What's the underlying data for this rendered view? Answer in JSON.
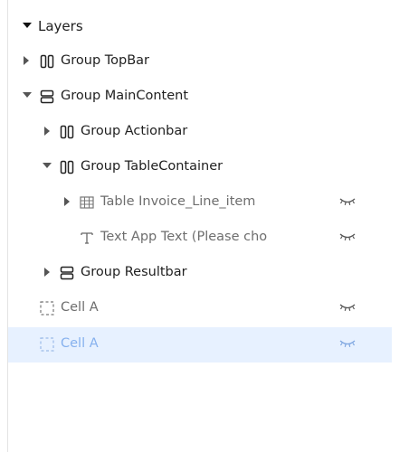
{
  "panel": {
    "title": "Layers"
  },
  "rows": [
    {
      "label": "Group TopBar"
    },
    {
      "label": "Group MainContent"
    },
    {
      "label": "Group Actionbar"
    },
    {
      "label": "Group TableContainer"
    },
    {
      "label": "Table Invoice_Line_item"
    },
    {
      "label": "Text App Text (Please cho"
    },
    {
      "label": "Group Resultbar"
    },
    {
      "label": "Cell A"
    },
    {
      "label": "Cell A"
    }
  ],
  "icons": {
    "collapsed": "caret-right",
    "expanded": "caret-down",
    "horizontal_group": "columns-icon",
    "vertical_group": "rows-icon",
    "table": "table-icon",
    "text": "text-icon",
    "cell": "dashed-square-icon",
    "hidden": "eye-closed-icon"
  },
  "colors": {
    "selected_row_bg": "#e7f1ff",
    "selected_text": "#86b1ee",
    "muted_text": "#6e6e6e",
    "primary_text": "#1f1f1f"
  }
}
